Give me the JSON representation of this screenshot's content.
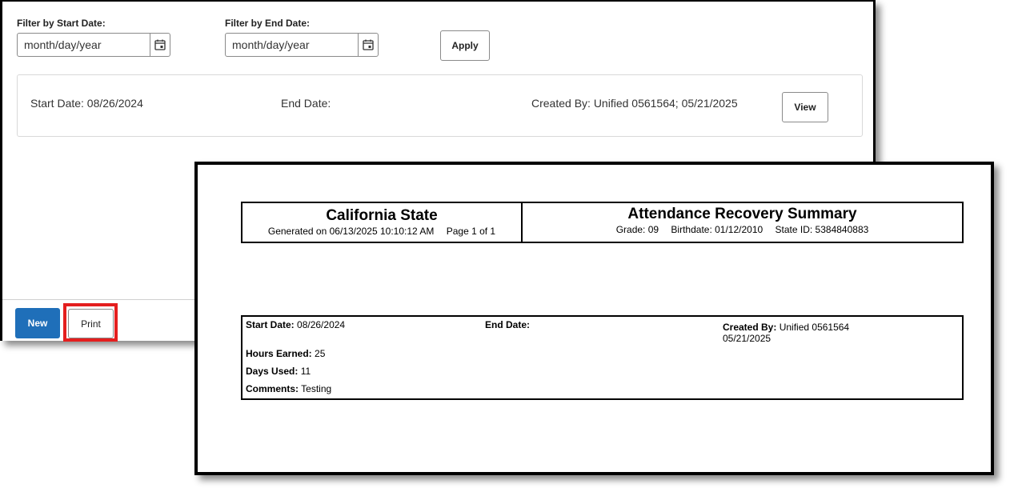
{
  "filters": {
    "start_label": "Filter by Start Date:",
    "start_placeholder": "month/day/year",
    "end_label": "Filter by End Date:",
    "end_placeholder": "month/day/year",
    "apply_label": "Apply"
  },
  "record": {
    "start": "Start Date: 08/26/2024",
    "end": "End Date:",
    "created": "Created By: Unified 0561564; 05/21/2025",
    "view_label": "View"
  },
  "footer": {
    "new_label": "New",
    "print_label": "Print"
  },
  "report": {
    "school": "California State",
    "generated": "Generated on 06/13/2025 10:10:12 AM",
    "page": "Page 1 of  1",
    "title": "Attendance Recovery Summary",
    "grade": "Grade: 09",
    "birthdate": "Birthdate: 01/12/2010",
    "state_id": "State ID: 5384840883",
    "start_label": "Start Date:",
    "start_value": "08/26/2024",
    "end_label": "End Date:",
    "created_label": "Created By:",
    "created_value": "Unified 0561564",
    "created_date": "05/21/2025",
    "hours_label": "Hours Earned:",
    "hours_value": "25",
    "days_label": "Days Used:",
    "days_value": "11",
    "comments_label": "Comments:",
    "comments_value": "Testing"
  },
  "colors": {
    "primary_button": "#1f6fb9",
    "highlight": "#e41e1e"
  },
  "icons": {
    "calendar": "calendar-icon"
  }
}
